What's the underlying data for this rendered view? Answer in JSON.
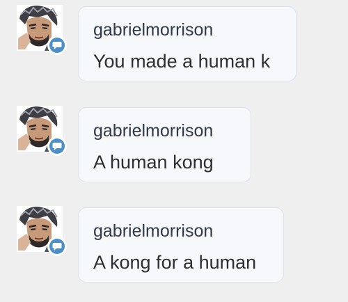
{
  "messages": [
    {
      "username": "gabrielmorrison",
      "text": "You made a human k",
      "avatar_icon": "user-avatar-illustration",
      "badge_icon": "chat-bubble-icon"
    },
    {
      "username": "gabrielmorrison",
      "text": "A human kong",
      "avatar_icon": "user-avatar-illustration",
      "badge_icon": "chat-bubble-icon"
    },
    {
      "username": "gabrielmorrison",
      "text": "A kong for a human",
      "avatar_icon": "user-avatar-illustration",
      "badge_icon": "chat-bubble-icon"
    }
  ],
  "colors": {
    "background": "#efefef",
    "bubble": "#f6f8fb",
    "bubble_border": "#dde3ea",
    "username": "#31394a",
    "text": "#2e2f33",
    "badge": "#4a8fcb"
  }
}
